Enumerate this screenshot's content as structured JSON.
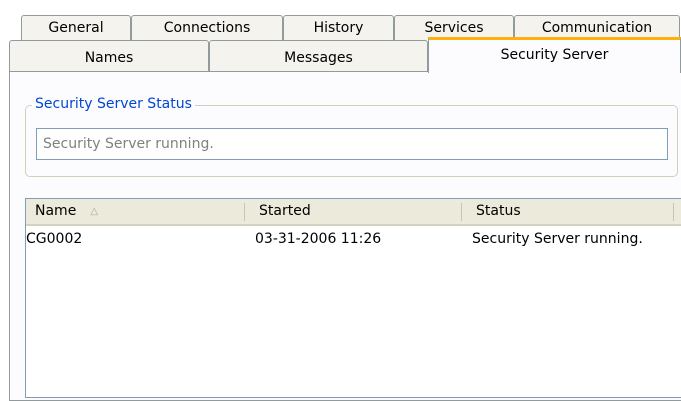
{
  "tabs": {
    "row1": [
      "General",
      "Connections",
      "History",
      "Services",
      "Communication"
    ],
    "row2": [
      "Names",
      "Messages",
      "Security Server"
    ],
    "active": "Security Server"
  },
  "status_group": {
    "legend": "Security Server Status",
    "field_text": "Security Server running."
  },
  "list": {
    "columns": [
      "Name",
      "Started",
      "Status"
    ],
    "sort_column": "Name",
    "sort_direction": "ascending",
    "rows": [
      {
        "name": "CG0002",
        "started": "03-31-2006 11:26",
        "status": "Security Server running."
      }
    ]
  },
  "colors": {
    "active_tab_accent": "#ffb00b",
    "group_legend": "#0046d5"
  },
  "icons": {
    "sort": "sort-ascending-icon"
  }
}
